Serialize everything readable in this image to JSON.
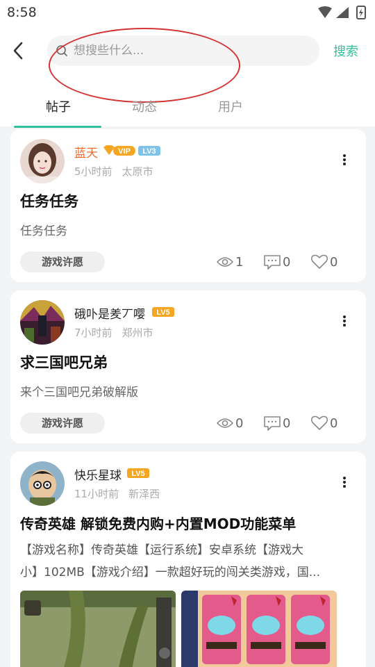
{
  "status": {
    "time": "8:58"
  },
  "search": {
    "placeholder": "想搜些什么...",
    "button_label": "搜索"
  },
  "tabs": [
    {
      "label": "帖子",
      "active": true
    },
    {
      "label": "动态",
      "active": false
    },
    {
      "label": "用户",
      "active": false
    }
  ],
  "posts": [
    {
      "author": "蓝天",
      "badges": [
        "VIP",
        "LV3"
      ],
      "time": "5小时前",
      "location": "太原市",
      "title": "任务任务",
      "body": "任务任务",
      "tag": "游戏许愿",
      "views": "1",
      "comments": "0",
      "likes": "0"
    },
    {
      "author": "硪卟是羑丆嘤",
      "badges": [
        "LV5"
      ],
      "time": "7小时前",
      "location": "郑州市",
      "title": "求三国吧兄弟",
      "body": "来个三国吧兄弟破解版",
      "tag": "游戏许愿",
      "views": "0",
      "comments": "0",
      "likes": "0"
    },
    {
      "author": "快乐星球",
      "badges": [
        "LV5"
      ],
      "time": "11小时前",
      "location": "新泽西",
      "title": "传奇英雄 解锁免费内购+内置MOD功能菜单",
      "body_line1": "【游戏名称】传奇英雄【运行系统】安卓系统【游戏大",
      "body_line2": "小】102MB【游戏介绍】一款超好玩的闯关类游戏，国..."
    }
  ],
  "colors": {
    "accent": "#2fbf9c",
    "vip_name": "#f36a2b",
    "lv_badge": "#f5a623",
    "lv3_badge": "#7fc4e8"
  }
}
